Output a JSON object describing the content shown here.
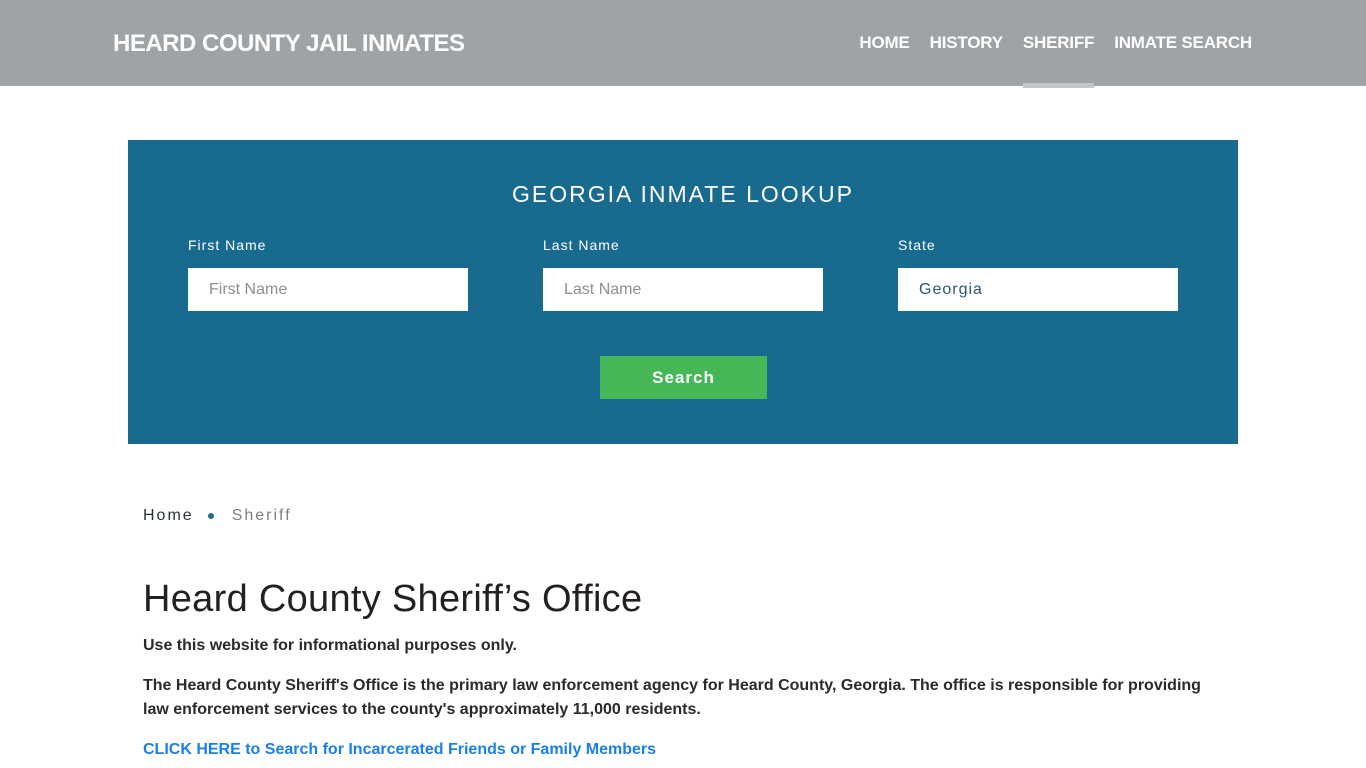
{
  "header": {
    "brand": "HEARD COUNTY JAIL INMATES",
    "nav": [
      {
        "label": "HOME",
        "active": false
      },
      {
        "label": "HISTORY",
        "active": false
      },
      {
        "label": "SHERIFF",
        "active": true
      },
      {
        "label": "INMATE SEARCH",
        "active": false
      }
    ]
  },
  "lookup": {
    "title": "GEORGIA INMATE LOOKUP",
    "first_name": {
      "label": "First Name",
      "placeholder": "First Name",
      "value": ""
    },
    "last_name": {
      "label": "Last Name",
      "placeholder": "Last Name",
      "value": ""
    },
    "state": {
      "label": "State",
      "value": "Georgia"
    },
    "search_label": "Search"
  },
  "breadcrumb": {
    "home": "Home",
    "current": "Sheriff"
  },
  "content": {
    "title": "Heard County Sheriff’s Office",
    "disclaimer": "Use this website for informational purposes only.",
    "description": "The Heard County Sheriff's Office is the primary law enforcement agency for Heard County, Georgia. The office is responsible for providing law enforcement services to the county's approximately 11,000 residents.",
    "cta_link": "CLICK HERE to Search for Incarcerated Friends or Family Members"
  },
  "colors": {
    "header_bg": "#9fa3a6",
    "lookup_bg": "#186a8e",
    "search_button": "#45b757",
    "link": "#1a7fe8"
  }
}
